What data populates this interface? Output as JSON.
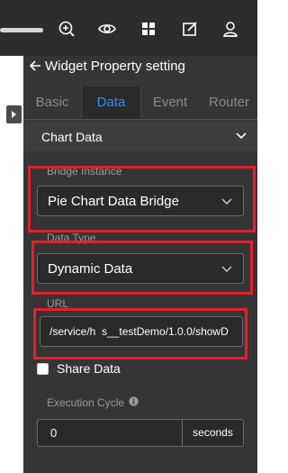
{
  "toolbar": {
    "icons": [
      "zoom-in-icon",
      "eye-icon",
      "grid-icon",
      "edit-icon",
      "user-icon"
    ],
    "icon_color": "#ffffff"
  },
  "panel": {
    "title": "Widget Property setting",
    "tabs": [
      {
        "label": "Basic",
        "active": false
      },
      {
        "label": "Data",
        "active": true
      },
      {
        "label": "Event",
        "active": false
      },
      {
        "label": "Router",
        "active": false
      }
    ],
    "section_title": "Chart Data",
    "bridge_instance": {
      "label": "Bridge Instance",
      "value": "Pie Chart Data Bridge"
    },
    "data_type": {
      "label": "Data Type",
      "value": "Dynamic Data"
    },
    "url": {
      "label": "URL",
      "value": "/service/h  s__testDemo/1.0.0/showD"
    },
    "share_data": {
      "label": "Share Data",
      "checked": false
    },
    "execution_cycle": {
      "label": "Execution Cycle",
      "value": "0",
      "unit": "seconds"
    }
  },
  "colors": {
    "accent": "#2f8cff",
    "highlight": "#e3202c",
    "panel_bg": "#353535",
    "toolbar_bg": "#2d2d2d"
  }
}
